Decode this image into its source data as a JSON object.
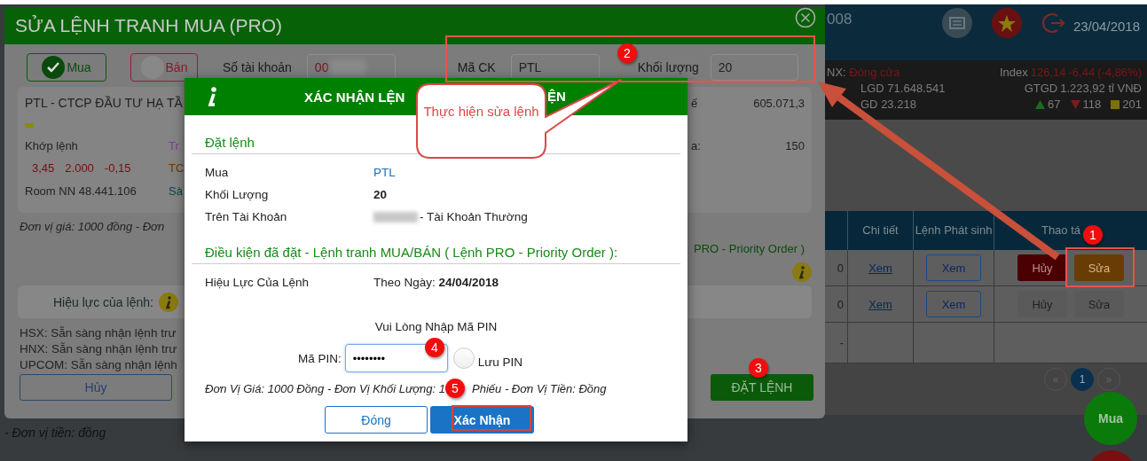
{
  "top_bar": {
    "account_fragment": "008",
    "date": "23/04/2018"
  },
  "market": {
    "exchange_fragment": "NX:",
    "status": "Đóng cửa",
    "index_label": "Index",
    "index_value": "126,14",
    "index_change": "-6,44",
    "index_percent": "(-4,86%)",
    "volume_label": "LGD",
    "volume": "71.648.541",
    "value_label": "GTGD",
    "value": "1.223,92 tỉ VNĐ",
    "trades_label": "GD",
    "trades": "23.218",
    "up": "67",
    "down": "118",
    "unchanged": "201"
  },
  "orders_table": {
    "columns": [
      "Chi tiết",
      "Lệnh Phát sinh",
      "Thao tá"
    ],
    "rows": [
      {
        "column_1": "0",
        "detail": "Xem",
        "spawned": "Xem",
        "cancel": "Hủy",
        "edit": "Sửa",
        "active": true
      },
      {
        "column_1": "0",
        "detail": "Xem",
        "spawned": "Xem",
        "cancel": "Hủy",
        "edit": "Sửa",
        "active": false
      }
    ],
    "empty_row": "-"
  },
  "pagination": {
    "prev": "«",
    "page": "1",
    "next": "»"
  },
  "fab": "Mua",
  "footer_note": "- Đơn vị tiền: đồng",
  "edit_dialog": {
    "title": "SỬA LỆNH TRANH MUA (PRO)",
    "sides": [
      {
        "label": "Mua",
        "selected": true
      },
      {
        "label": "Bán",
        "selected": false
      }
    ],
    "account_label": "Số tài khoản",
    "account_value": "00",
    "symbol_label": "Mã CK",
    "symbol": "PTL",
    "quantity_label": "Khối lượng",
    "quantity": "20",
    "stock_name": "PTL - CTCP ĐẦU TƯ HẠ TẦ",
    "match_label": "Khớp lệnh",
    "prices": [
      "3,45",
      "2.000",
      "-0,15"
    ],
    "room_label": "Room NN",
    "room_value": "48.441.106",
    "cut_labels": [
      {
        "text": "Tr",
        "color": "#7a3c8a"
      },
      {
        "text": "TC",
        "color": "#6a3a00"
      },
      {
        "text": "Sà",
        "color": "#004a4a"
      }
    ],
    "right_rows": [
      {
        "label": "ế",
        "value": "605.071,3"
      },
      {
        "label": "a:",
        "value": "150"
      }
    ],
    "price_unit": "Đơn vị giá: 1000 đồng - Đơn",
    "condition_fragment": "PRO - Priority Order )",
    "validity_label": "Hiệu lực của lệnh:",
    "exchange_lines": [
      {
        "exchange": "HSX:",
        "text": "Sẵn sàng nhận lệnh trư"
      },
      {
        "exchange": "HNX:",
        "text": "Sẵn sàng nhận lệnh trư"
      },
      {
        "exchange": "UPCOM:",
        "text": "Sẵn sàng nhận lệnh"
      }
    ],
    "cancel": "Hủy",
    "submit": "ĐẶT LỆNH"
  },
  "confirm_dialog": {
    "title_start": "XÁC NHẬN LỆN",
    "title_end": "ỆN",
    "section": "Đặt lệnh",
    "details": [
      {
        "label": "Mua",
        "value": "PTL",
        "kind": "symbol"
      },
      {
        "label": "Khối Lượng",
        "value": "20",
        "kind": "plain"
      },
      {
        "label": "Trên Tài Khoản",
        "value": "- Tài Khoản Thường",
        "kind": "account"
      }
    ],
    "conditions_title": "Điều kiện đã đặt - Lệnh tranh MUA/BÁN ( Lệnh PRO - Priority Order ):",
    "validity_label": "Hiệu Lực Của Lệnh",
    "validity_value": "Theo Ngày: **24/04/2018**",
    "pin_prompt": "Vui Lòng Nhập Mã PIN",
    "pin_label": "Mã PIN:",
    "pin_value": "••••••••",
    "save_pin": {
      "label": "Lưu PIN",
      "checked": false
    },
    "units_note_start": "Đơn Vị Giá: 1000 Đồng - Đơn Vị Khối Lượng: 1",
    "units_note_end": "Phiếu - Đơn Vị Tiền: Đồng",
    "close": "Đóng",
    "confirm": "Xác Nhận"
  },
  "annotations": {
    "steps": [
      "1",
      "2",
      "3",
      "4",
      "5"
    ],
    "callout": "Thực hiện sửa lệnh"
  }
}
